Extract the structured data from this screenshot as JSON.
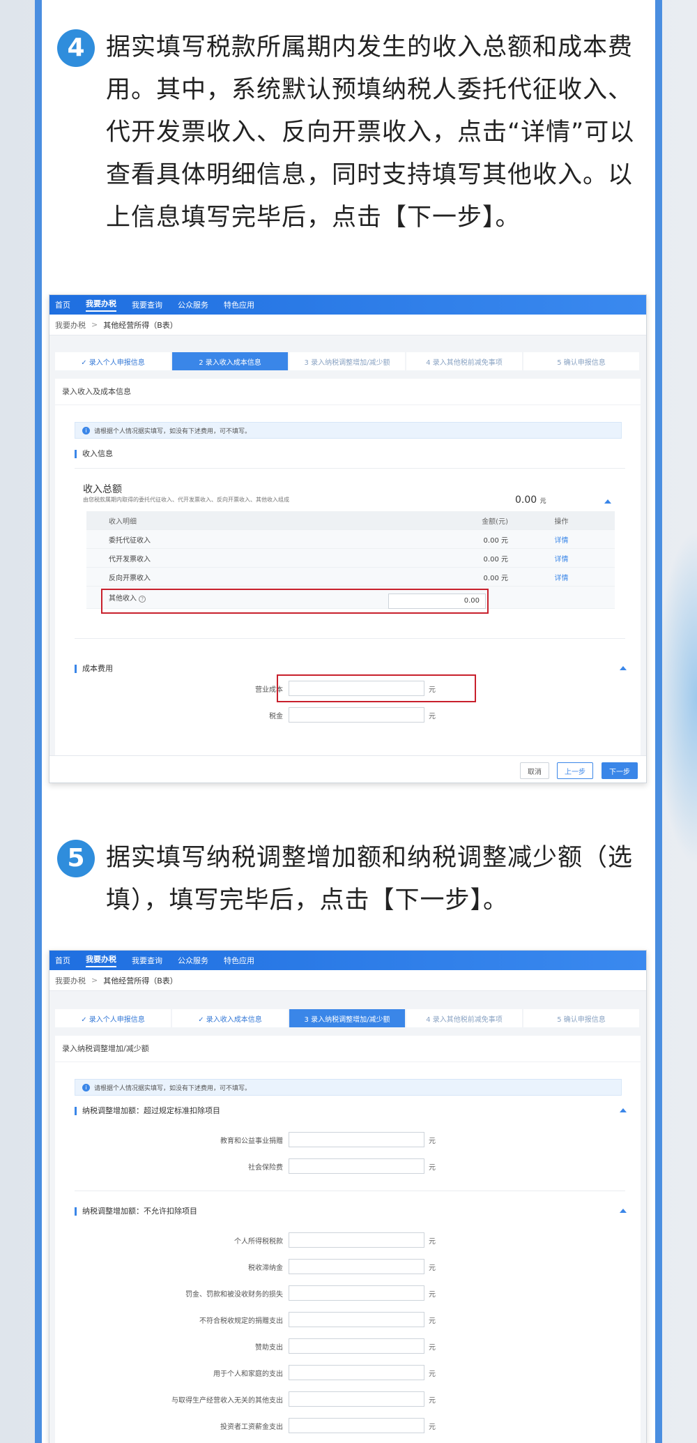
{
  "step4": {
    "number": "4",
    "text": "据实填写税款所属期内发生的收入总额和成本费用。其中，系统默认预填纳税人委托代征收入、代开发票收入、反向开票收入，点击“详情”可以查看具体明细信息，同时支持填写其他收入。以上信息填写完毕后，点击【下一步】。"
  },
  "step5": {
    "number": "5",
    "text": "据实填写纳税调整增加额和纳税调整减少额（选填），填写完毕后，点击【下一步】。"
  },
  "nav": [
    "首页",
    "我要办税",
    "我要查询",
    "公众服务",
    "特色应用"
  ],
  "breadcrumb": {
    "root": "我要办税",
    "sep": ">",
    "current": "其他经营所得（B表）"
  },
  "steps": [
    "✓ 录入个人申报信息",
    "✓ 录入收入成本信息",
    "3  录入纳税调整增加/减少额",
    "4  录入其他税前减免事项",
    "5  确认申报信息"
  ],
  "steps_shot1": [
    "✓ 录入个人申报信息",
    "2  录入收入成本信息",
    "3  录入纳税调整增加/减少额",
    "4  录入其他税前减免事项",
    "5  确认申报信息"
  ],
  "shot1": {
    "card_title": "录入收入及成本信息",
    "notice": "请根据个人情况据实填写，如没有下述费用，可不填写。",
    "income_section": "收入信息",
    "total_label": "收入总额",
    "total_desc": "由您税款属期内取得的委托代征收入、代开发票收入、反向开票收入、其他收入组成",
    "total_value": "0.00",
    "total_unit": "元",
    "table_head": [
      "收入明细",
      "金额(元)",
      "操作"
    ],
    "rows": [
      {
        "name": "委托代征收入",
        "amount": "0.00 元",
        "op": "详情"
      },
      {
        "name": "代开发票收入",
        "amount": "0.00 元",
        "op": "详情"
      },
      {
        "name": "反向开票收入",
        "amount": "0.00 元",
        "op": "详情"
      }
    ],
    "other_income_label": "其他收入",
    "other_income_value": "0.00",
    "cost_section": "成本费用",
    "cost_fields": [
      "营业成本",
      "税金"
    ],
    "unit": "元",
    "btn_cancel": "取消",
    "btn_prev": "上一步",
    "btn_next": "下一步"
  },
  "shot2": {
    "card_title": "录入纳税调整增加/减少额",
    "notice": "请根据个人情况据实填写，如没有下述费用，可不填写。",
    "section1": "纳税调整增加额：超过规定标准扣除项目",
    "section1_fields": [
      "教育和公益事业捐赠",
      "社会保险费"
    ],
    "section2": "纳税调整增加额：不允许扣除项目",
    "section2_fields": [
      "个人所得税税款",
      "税收滞纳金",
      "罚金、罚款和被没收财务的损失",
      "不符合税收规定的捐赠支出",
      "赞助支出",
      "用于个人和家庭的支出",
      "与取得生产经营收入无关的其他支出",
      "投资者工资薪金支出"
    ],
    "unit": "元"
  }
}
